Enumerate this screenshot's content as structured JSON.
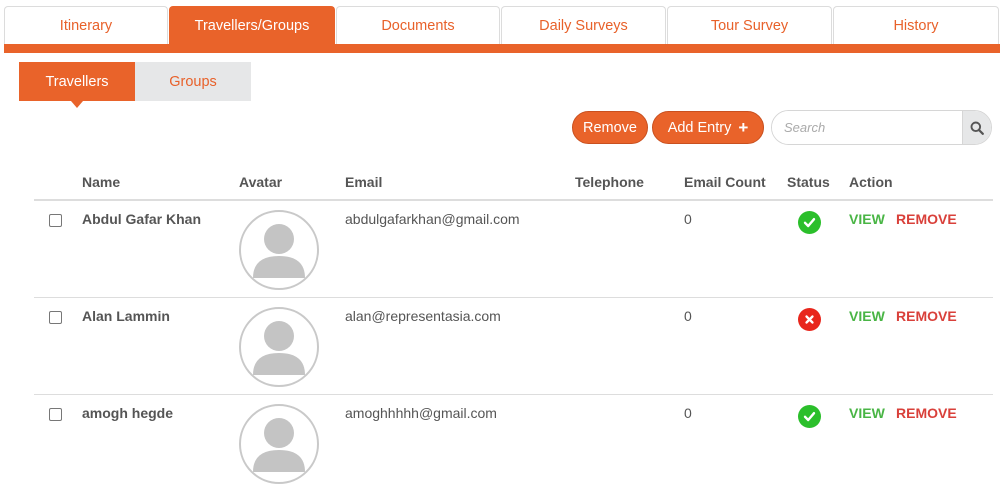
{
  "top_tabs": [
    {
      "label": "Itinerary",
      "active": false
    },
    {
      "label": "Travellers/Groups",
      "active": true
    },
    {
      "label": "Documents",
      "active": false
    },
    {
      "label": "Daily Surveys",
      "active": false
    },
    {
      "label": "Tour Survey",
      "active": false
    },
    {
      "label": "History",
      "active": false
    }
  ],
  "sub_tabs": [
    {
      "label": "Travellers",
      "active": true
    },
    {
      "label": "Groups",
      "active": false
    }
  ],
  "actions": {
    "remove_label": "Remove",
    "add_entry_label": "Add Entry",
    "add_icon": "plus-icon",
    "search_placeholder": "Search",
    "search_icon": "search-icon"
  },
  "table": {
    "headers": [
      "Name",
      "Avatar",
      "Email",
      "Telephone",
      "Email Count",
      "Status",
      "Action"
    ],
    "rows": [
      {
        "name": "Abdul Gafar Khan",
        "email": "abdulgafarkhan@gmail.com",
        "telephone": "",
        "email_count": "0",
        "status": "active",
        "view": "VIEW",
        "remove": "REMOVE"
      },
      {
        "name": "Alan Lammin",
        "email": "alan@representasia.com",
        "telephone": "",
        "email_count": "0",
        "status": "inactive",
        "view": "VIEW",
        "remove": "REMOVE"
      },
      {
        "name": "amogh hegde",
        "email": "amoghhhhh@gmail.com",
        "telephone": "",
        "email_count": "0",
        "status": "active",
        "view": "VIEW",
        "remove": "REMOVE"
      }
    ]
  },
  "colors": {
    "accent": "#e9632a",
    "status_ok": "#2bbf2b",
    "status_bad": "#e8261c",
    "view_link": "#49b545",
    "remove_link": "#d9403a"
  }
}
